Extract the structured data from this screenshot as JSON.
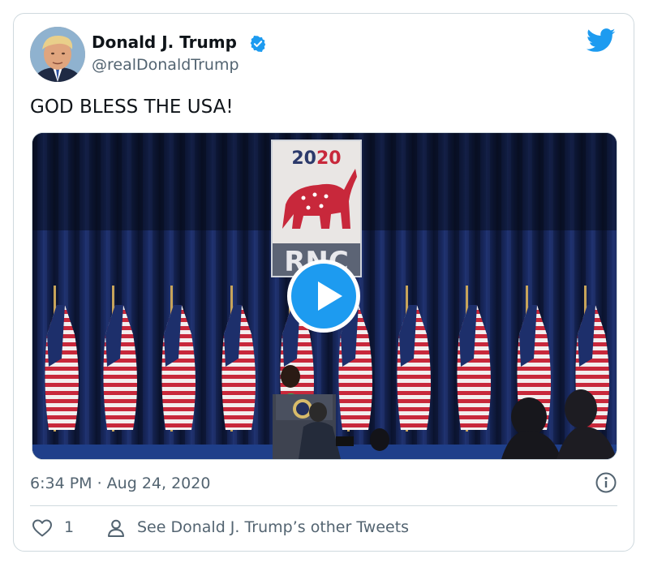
{
  "author": {
    "name": "Donald J. Trump",
    "handle": "@realDonaldTrump",
    "verified": true
  },
  "tweet": {
    "text": "GOD BLESS THE USA!"
  },
  "media": {
    "type": "video",
    "backdrop_sign_year": "2020",
    "backdrop_sign_text": "RNC"
  },
  "meta": {
    "timestamp": "6:34 PM · Aug 24, 2020"
  },
  "actions": {
    "like_count": "1",
    "see_more_label": "See Donald J. Trump’s other Tweets"
  },
  "colors": {
    "accent": "#1d9bf0",
    "text_secondary": "#536471",
    "border": "#cfd9de"
  },
  "icons": {
    "brand": "twitter-bird-icon",
    "verified": "verified-badge-icon",
    "info": "info-icon",
    "like": "heart-icon",
    "profile": "person-icon",
    "play": "play-icon"
  }
}
